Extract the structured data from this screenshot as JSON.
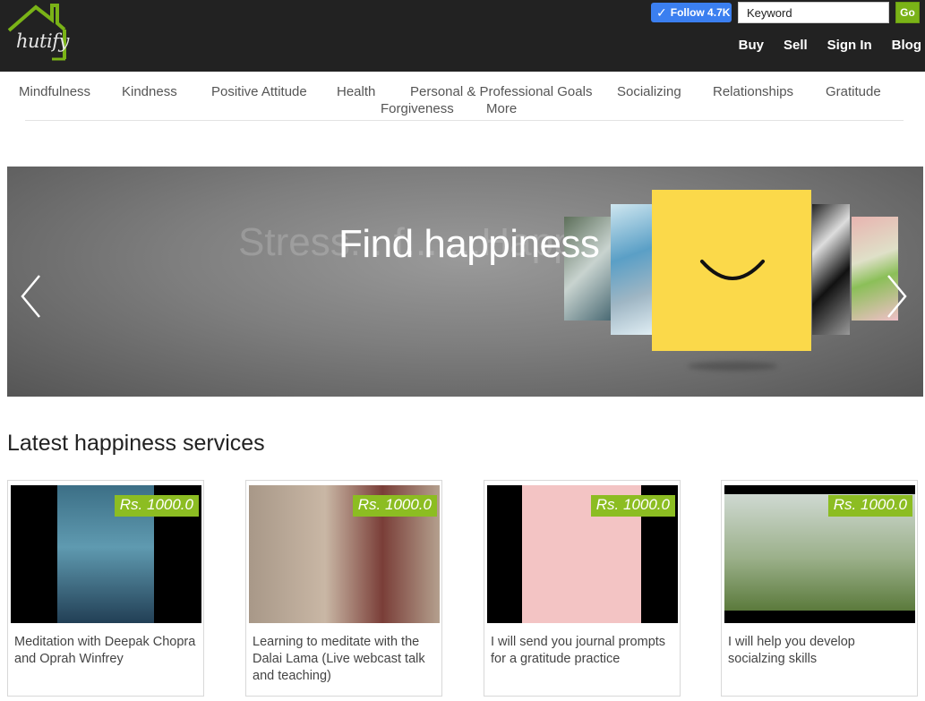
{
  "header": {
    "logo_text": "hutify",
    "follow_label": "Follow 4.7K",
    "search_placeholder": "Keyword",
    "go_label": "Go",
    "links": [
      "Buy",
      "Sell",
      "Sign In",
      "Blog"
    ]
  },
  "nav": {
    "categories": [
      "Mindfulness",
      "Kindness",
      "Positive Attitude",
      "Health",
      "Personal & Professional Goals",
      "Socializing",
      "Relationships",
      "Gratitude",
      "Forgiveness",
      "More"
    ]
  },
  "hero": {
    "ghost_text": "Stress... f... ...Happily",
    "title": "Find happiness"
  },
  "services": {
    "title": "Latest happiness services",
    "cards": [
      {
        "price": "Rs. 1000.0",
        "title": "Meditation with Deepak Chopra and Oprah Winfrey"
      },
      {
        "price": "Rs. 1000.0",
        "title": "Learning to meditate with the Dalai Lama (Live webcast talk and teaching)"
      },
      {
        "price": "Rs. 1000.0",
        "title": "I will send you journal prompts for a gratitude practice"
      },
      {
        "price": "Rs. 1000.0",
        "title": "I will help you develop socialzing skills"
      }
    ]
  },
  "colors": {
    "topbar": "#222222",
    "accent_green": "#8cbd22",
    "follow_blue": "#3b7ff0",
    "hero_tile": "#fbd94a"
  }
}
